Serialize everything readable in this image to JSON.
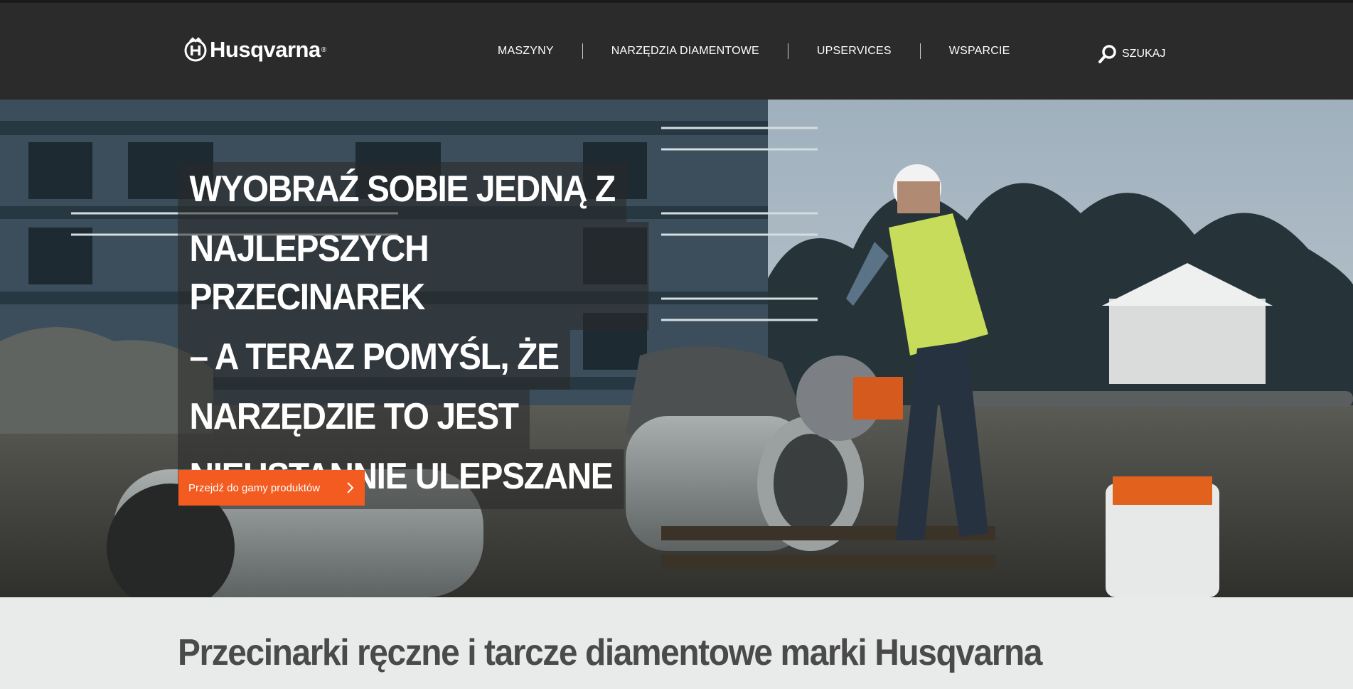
{
  "header": {
    "logo_text": "Husqvarna",
    "logo_reg": "®",
    "nav": [
      {
        "label": "MASZYNY"
      },
      {
        "label": "NARZĘDZIA DIAMENTOWE"
      },
      {
        "label": "UPSERVICES"
      },
      {
        "label": "WSPARCIE"
      }
    ],
    "search_label": "SZUKAJ"
  },
  "hero": {
    "headline_lines": [
      "WYOBRAŹ SOBIE JEDNĄ Z",
      "NAJLEPSZYCH PRZECINAREK",
      "– A TERAZ POMYŚL, ŻE",
      "NARZĘDZIE TO JEST",
      "NIEUSTANNIE ULEPSZANE"
    ],
    "cta_label": "Przejdź do gamy produktów"
  },
  "section": {
    "title": "Przecinarki ręczne i tarcze diamentowe marki Husqvarna"
  },
  "colors": {
    "header_bg": "#2b2b2b",
    "accent": "#f35b20",
    "section_bg": "#e9eaea",
    "section_title": "#4a4a4a"
  },
  "icons": {
    "logo": "husqvarna-crown-icon",
    "search": "search-icon",
    "cta": "chevron-right-icon"
  }
}
